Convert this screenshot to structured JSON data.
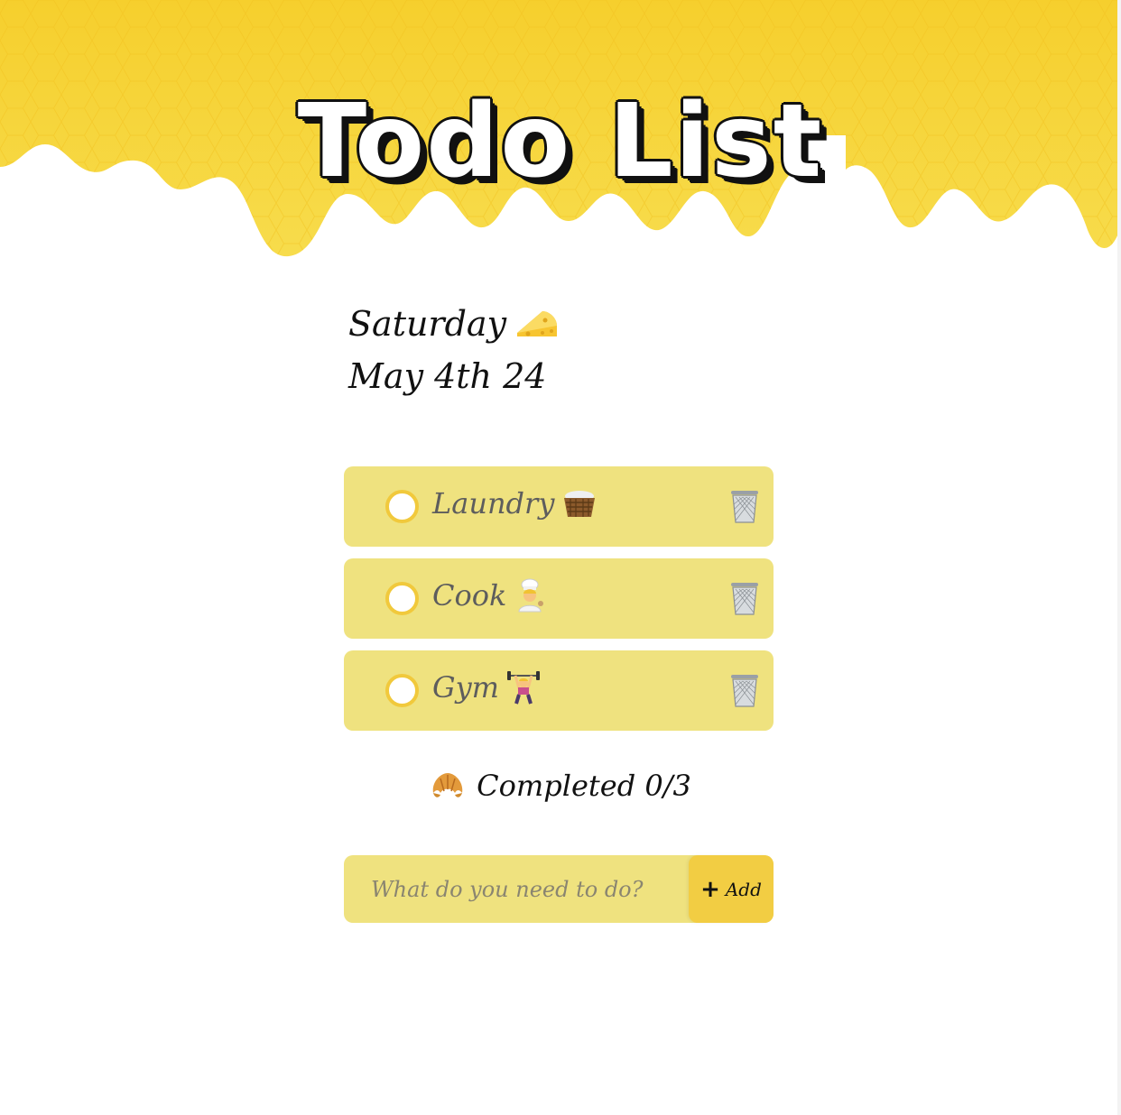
{
  "header": {
    "title": "Todo List"
  },
  "date": {
    "day": "Saturday",
    "full": "May 4th 24",
    "icon": "cheese-icon"
  },
  "todos": [
    {
      "label": "Laundry",
      "icon": "laundry-basket-icon",
      "done": false
    },
    {
      "label": "Cook",
      "icon": "cook-icon",
      "done": false
    },
    {
      "label": "Gym",
      "icon": "weightlifter-icon",
      "done": false
    }
  ],
  "summary": {
    "label": "Completed 0/3",
    "icon": "croissant-icon"
  },
  "form": {
    "placeholder": "What do you need to do?",
    "add_plus": "+",
    "add_label": "Add"
  },
  "colors": {
    "honey": "#f5d23a",
    "item_bg": "#efe27f",
    "check_border": "#f1c93c",
    "add_button": "#f2cd43"
  }
}
